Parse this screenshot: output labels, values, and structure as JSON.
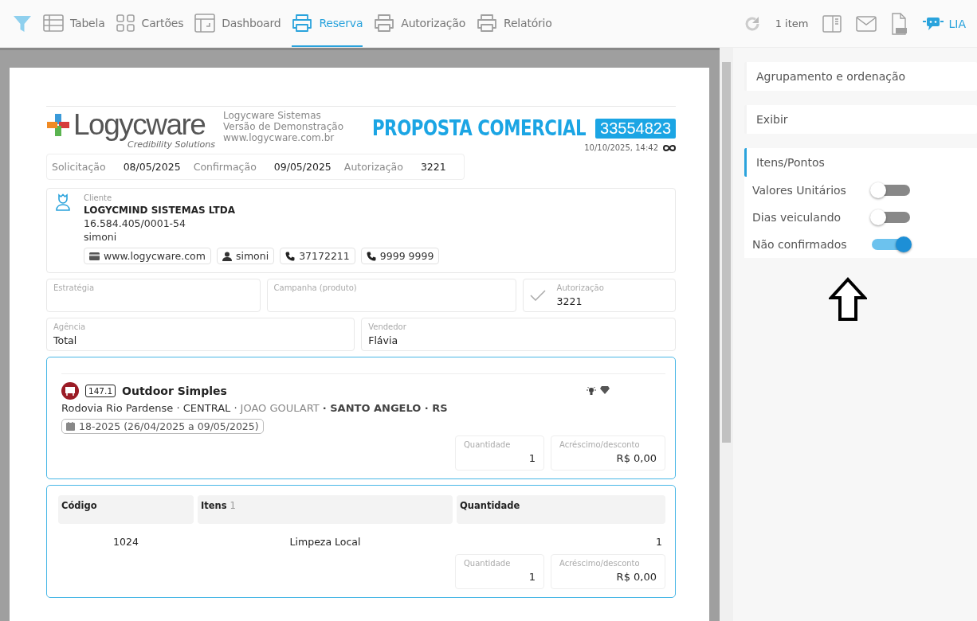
{
  "toolbar": {
    "tabs": [
      {
        "label": "Tabela",
        "kind": "table",
        "selected": false
      },
      {
        "label": "Cartões",
        "kind": "cards",
        "selected": false
      },
      {
        "label": "Dashboard",
        "kind": "dashboard",
        "selected": false
      },
      {
        "label": "Reserva",
        "kind": "printer",
        "selected": true
      },
      {
        "label": "Autorização",
        "kind": "printer",
        "selected": false
      },
      {
        "label": "Relatório",
        "kind": "printer",
        "selected": false
      }
    ],
    "count": "1 item",
    "assistant": "LIA"
  },
  "document": {
    "company": {
      "logo_name": "Logycware",
      "tagline": "Credibility Solutions",
      "lines": [
        "Logycware Sistemas",
        "Versão de Demonstração",
        "www.logycware.com.br"
      ]
    },
    "title": "PROPOSTA COMERCIAL",
    "number": "33554823",
    "timestamp": "10/10/2025, 14:42",
    "dates": [
      {
        "label": "Solicitação",
        "value": "08/05/2025"
      },
      {
        "label": "Confirmação",
        "value": "09/05/2025"
      },
      {
        "label": "Autorização",
        "value": "3221"
      }
    ],
    "client": {
      "label": "Cliente",
      "name": "LOGYCMIND SISTEMAS LTDA",
      "document": "16.584.405/0001-54",
      "contact": "simoni",
      "chips": [
        {
          "kind": "web",
          "text": "www.logycware.com"
        },
        {
          "kind": "person",
          "text": "simoni"
        },
        {
          "kind": "phone",
          "text": "37172211"
        },
        {
          "kind": "phone",
          "text": "9999 9999"
        }
      ]
    },
    "fields_row_1": [
      {
        "label": "Estratégia"
      },
      {
        "label": "Campanha (produto)"
      },
      {
        "label": "Autorização",
        "value": "3221",
        "checked": true
      }
    ],
    "fields_row_2": [
      {
        "label": "Agência",
        "value": "Total"
      },
      {
        "label": "Vendedor",
        "value": "Flávia"
      }
    ],
    "item": {
      "code": "147.1",
      "title": "Outdoor Simples",
      "address": [
        {
          "kind": "normal",
          "text": "Rodovia Rio Pardense · CENTRAL ·"
        },
        {
          "kind": "muted",
          "text": "JOAO GOULART"
        },
        {
          "kind": "bold",
          "text": "· SANTO ANGELO · RS"
        }
      ],
      "period": "18-2025 (26/04/2025 a 09/05/2025)",
      "fields": [
        {
          "label": "Quantidade",
          "value": "1"
        },
        {
          "label": "Acréscimo/desconto",
          "value": "R$ 0,00"
        }
      ]
    },
    "items_table": {
      "columns": [
        {
          "label": "Código"
        },
        {
          "label": "Itens",
          "count": "1"
        },
        {
          "label": "Quantidade"
        }
      ],
      "rows": [
        [
          "1024",
          "Limpeza Local",
          "1"
        ]
      ],
      "fields": [
        {
          "label": "Quantidade",
          "value": "1"
        },
        {
          "label": "Acréscimo/desconto",
          "value": "R$ 0,00"
        }
      ]
    }
  },
  "side_panel": {
    "sections": [
      {
        "title": "Agrupamento e ordenação",
        "active": false
      },
      {
        "title": "Exibir",
        "active": false
      },
      {
        "title": "Itens/Pontos",
        "active": true
      }
    ],
    "toggles": [
      {
        "label": "Valores Unitários",
        "on": false
      },
      {
        "label": "Dias veiculando",
        "on": false
      },
      {
        "label": "Não confirmados",
        "on": true
      }
    ]
  }
}
